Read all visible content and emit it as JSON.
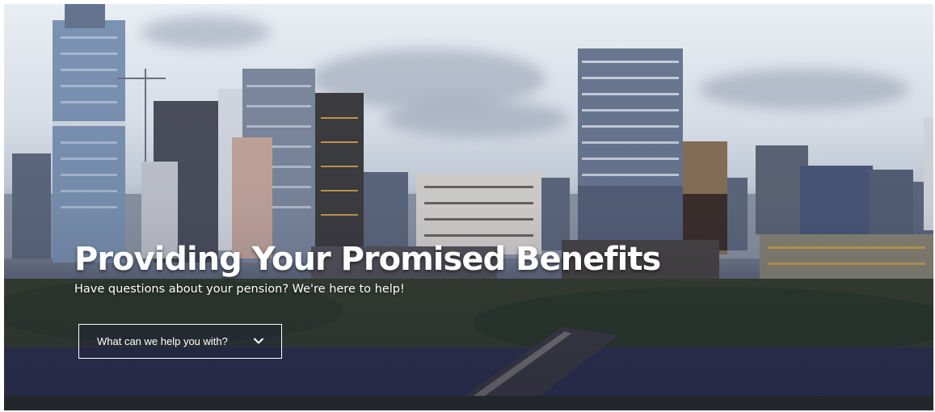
{
  "hero": {
    "title": "Providing Your Promised Benefits",
    "subtitle": "Have questions about your pension? We're here to help!",
    "background_image": "city-skyline-photo"
  },
  "help_dropdown": {
    "label": "What can we help you with?",
    "icon": "chevron-down-icon"
  },
  "colors": {
    "text": "#ffffff",
    "sky": "#e2e8ef",
    "water": "#2e3350"
  }
}
